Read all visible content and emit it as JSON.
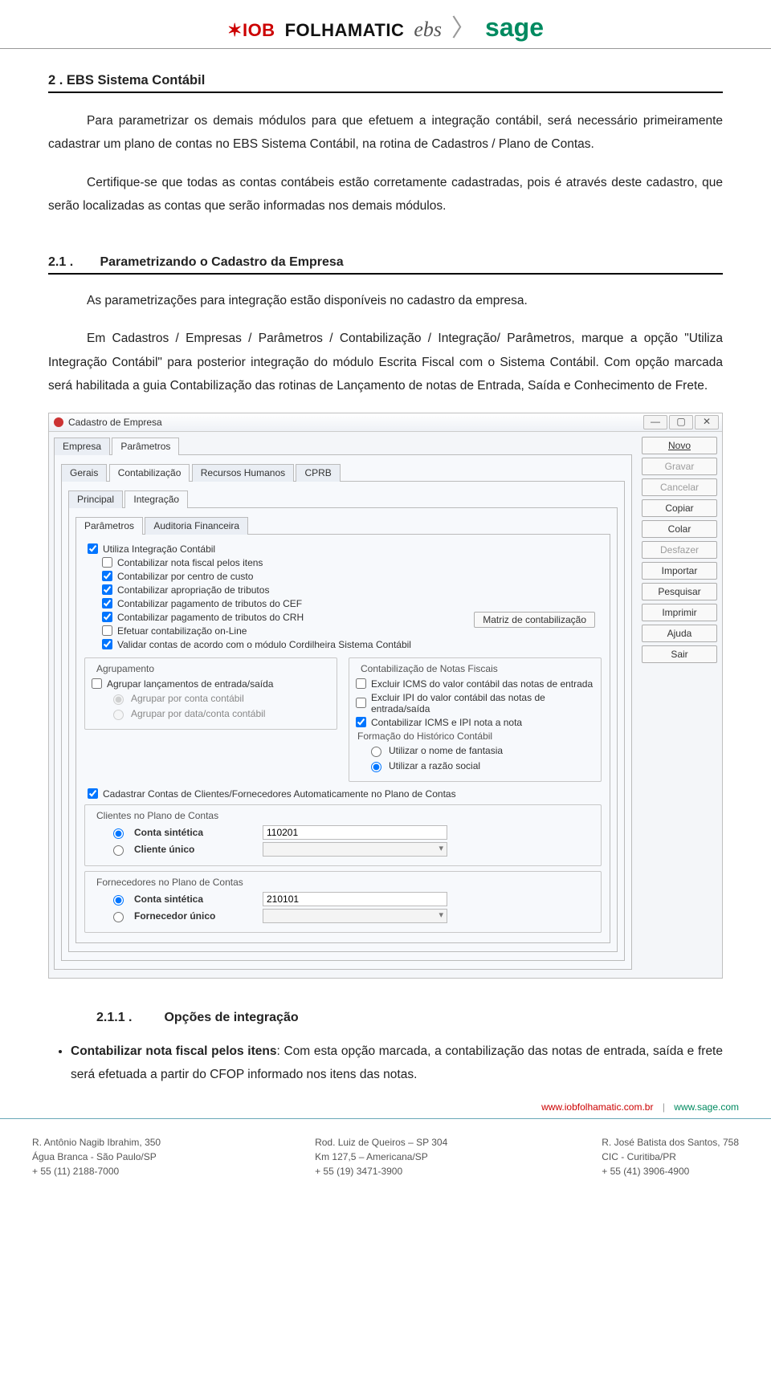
{
  "logos": {
    "iob": "IOB",
    "folhamatic": "FOLHAMATIC",
    "ebs": "ebs",
    "sage": "sage"
  },
  "section2": {
    "heading": "2 . EBS Sistema Contábil",
    "para1": "Para parametrizar os demais módulos para que efetuem a integração contábil, será necessário primeiramente cadastrar um plano de contas no EBS Sistema Contábil, na rotina de Cadastros / Plano de Contas.",
    "para2": "Certifique-se que todas as contas contábeis estão corretamente cadastradas, pois é através deste cadastro, que serão localizadas as contas que serão informadas nos demais módulos."
  },
  "section21": {
    "num": "2.1 .",
    "title": "Parametrizando o Cadastro da Empresa",
    "para1": "As parametrizações para integração estão disponíveis no cadastro da empresa.",
    "para2": "Em Cadastros / Empresas / Parâmetros / Contabilização / Integração/ Parâmetros, marque a opção \"Utiliza Integração Contábil\" para posterior integração do módulo Escrita Fiscal com o Sistema Contábil. Com opção marcada será habilitada a guia Contabilização das rotinas de Lançamento de notas de Entrada, Saída e Conhecimento de Frete."
  },
  "appwin": {
    "title": "Cadastro de Empresa",
    "tabs_lvl1": [
      "Empresa",
      "Parâmetros"
    ],
    "tabs_lvl1_active": 1,
    "tabs_lvl2": [
      "Gerais",
      "Contabilização",
      "Recursos Humanos",
      "CPRB"
    ],
    "tabs_lvl2_active": 1,
    "tabs_lvl3": [
      "Principal",
      "Integração"
    ],
    "tabs_lvl3_active": 1,
    "tabs_lvl4": [
      "Parâmetros",
      "Auditoria Financeira"
    ],
    "tabs_lvl4_active": 0,
    "checks": {
      "utiliza": "Utiliza Integração Contábil",
      "nf_itens": "Contabilizar nota fiscal pelos itens",
      "centro_custo": "Contabilizar por centro de custo",
      "aprop_trib": "Contabilizar apropriação de tributos",
      "pag_cef": "Contabilizar pagamento de tributos do CEF",
      "pag_crh": "Contabilizar pagamento de tributos do CRH",
      "online": "Efetuar contabilização on-Line",
      "validar": "Validar contas de acordo com o módulo Cordilheira Sistema Contábil",
      "cad_auto": "Cadastrar Contas de Clientes/Fornecedores Automaticamente no Plano de Contas"
    },
    "btn_matriz": "Matriz de contabilização",
    "grp_agrup": {
      "legend": "Agrupamento",
      "chk": "Agrupar lançamentos de entrada/saída",
      "r1": "Agrupar por conta contábil",
      "r2": "Agrupar por data/conta contábil"
    },
    "grp_contnf": {
      "legend": "Contabilização de Notas Fiscais",
      "c1": "Excluir ICMS do valor contábil das notas de entrada",
      "c2": "Excluir IPI do valor contábil das notas de entrada/saída",
      "c3": "Contabilizar ICMS e IPI nota a nota",
      "sub_legend": "Formação do Histórico Contábil",
      "r1": "Utilizar o nome de fantasia",
      "r2": "Utilizar a razão social"
    },
    "grp_cli": {
      "legend": "Clientes no Plano de Contas",
      "r1": "Conta sintética",
      "v1": "110201",
      "r2": "Cliente único"
    },
    "grp_for": {
      "legend": "Fornecedores no Plano de Contas",
      "r1": "Conta sintética",
      "v1": "210101",
      "r2": "Fornecedor único"
    },
    "sidebar": [
      "Novo",
      "Gravar",
      "Cancelar",
      "Copiar",
      "Colar",
      "Desfazer",
      "Importar",
      "Pesquisar",
      "Imprimir",
      "Ajuda",
      "Sair"
    ],
    "sidebar_disabled": [
      1,
      2,
      5
    ]
  },
  "section211": {
    "num": "2.1.1 .",
    "title": "Opções de integração",
    "bullet_bold": "Contabilizar nota fiscal pelos itens",
    "bullet_rest": ": Com esta opção marcada, a contabilização das notas de entrada, saída e frete será efetuada a partir do CFOP informado nos itens das notas."
  },
  "footer": {
    "link1": "www.iobfolhamatic.com.br",
    "link2": "www.sage.com",
    "col1": {
      "l1": "R. Antônio Nagib Ibrahim, 350",
      "l2": "Água Branca - São Paulo/SP",
      "l3": "+ 55 (11) 2188-7000"
    },
    "col2": {
      "l1": "Rod. Luiz de Queiros – SP 304",
      "l2": "Km 127,5 – Americana/SP",
      "l3": "+ 55 (19) 3471-3900"
    },
    "col3": {
      "l1": "R. José Batista dos Santos, 758",
      "l2": "CIC - Curitiba/PR",
      "l3": "+ 55 (41) 3906-4900"
    }
  }
}
